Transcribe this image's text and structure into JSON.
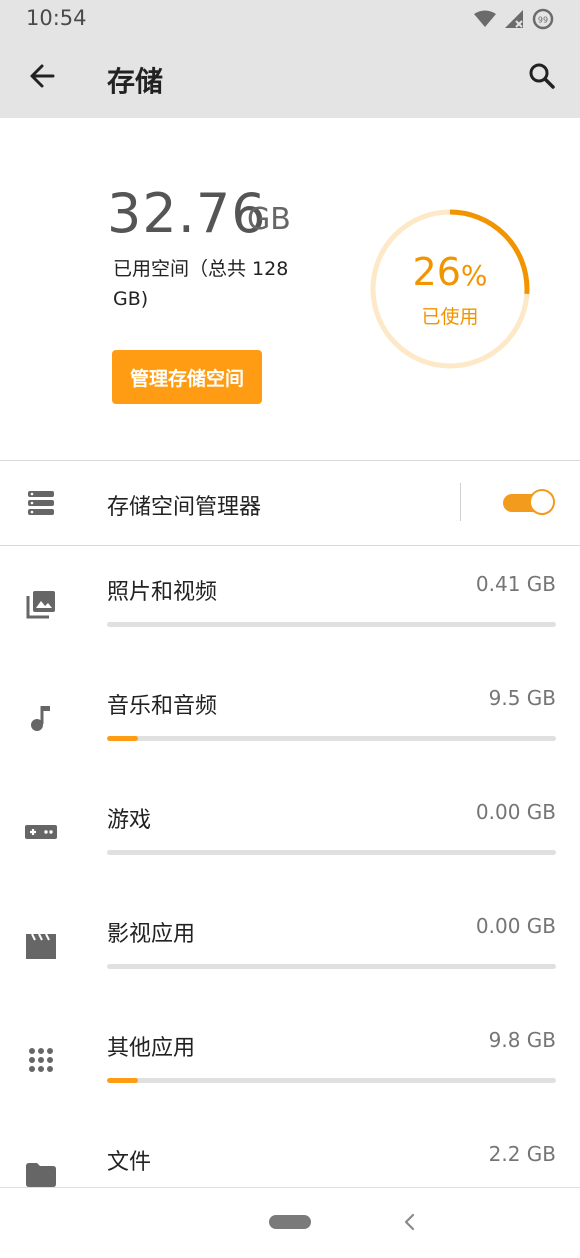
{
  "status_bar": {
    "time": "10:54",
    "badge": "99"
  },
  "app_bar": {
    "title": "存储"
  },
  "summary": {
    "used_value": "32.76",
    "used_unit": "GB",
    "used_desc": "已用空间（总共 128 GB)",
    "manage_button": "管理存储空间",
    "percent_value": "26",
    "percent_sign": "%",
    "percent_label": "已使用",
    "percent_fraction": 0.26
  },
  "storage_manager": {
    "label": "存储空间管理器",
    "enabled": true
  },
  "categories": [
    {
      "label": "照片和视频",
      "size": "0.41 GB",
      "fraction": 0.0
    },
    {
      "label": "音乐和音频",
      "size": "9.5 GB",
      "fraction": 0.07
    },
    {
      "label": "游戏",
      "size": "0.00 GB",
      "fraction": 0.0
    },
    {
      "label": "影视应用",
      "size": "0.00 GB",
      "fraction": 0.0
    },
    {
      "label": "其他应用",
      "size": "9.8 GB",
      "fraction": 0.07
    },
    {
      "label": "文件",
      "size": "2.2 GB",
      "fraction": 0.02
    }
  ],
  "colors": {
    "accent": "#ff9c14",
    "ring_track": "#fde8c7",
    "appbar": "#e4e4e4"
  }
}
